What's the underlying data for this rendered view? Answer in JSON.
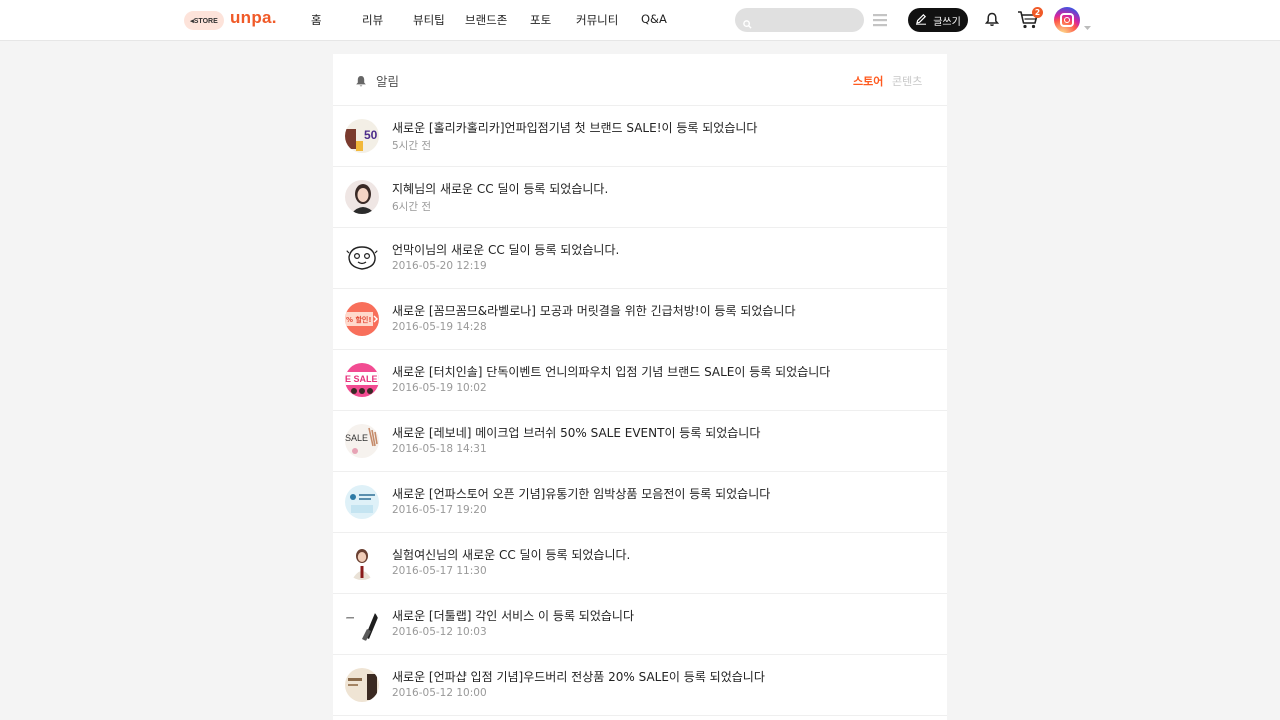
{
  "header": {
    "store_label": "◂STORE",
    "logo_text": "unpa.",
    "nav": [
      {
        "label": "홈"
      },
      {
        "label": "리뷰"
      },
      {
        "label": "뷰티팁"
      },
      {
        "label": "브랜드존"
      },
      {
        "label": "포토"
      },
      {
        "label": "커뮤니티"
      },
      {
        "label": "Q&A"
      }
    ],
    "search": {
      "placeholder": "",
      "value": ""
    },
    "write_label": "글쓰기",
    "cart_count": "2",
    "icons": [
      "search-icon",
      "menu-icon",
      "pencil-icon",
      "bell-icon",
      "cart-icon",
      "profile-avatar",
      "chevron-down-icon"
    ]
  },
  "notifications": {
    "title": "알림",
    "tabs": [
      {
        "label": "스토어",
        "active": true
      },
      {
        "label": "콘텐츠",
        "active": false
      }
    ],
    "items": [
      {
        "message": "새로운 [홀리카홀리카]언파입점기념 첫 브랜드 SALE!이 등록 되었습니다",
        "time": "5시간 전",
        "thumb": "50"
      },
      {
        "message": "지혜님의 새로운 CC 딜이 등록 되었습니다.",
        "time": "6시간 전",
        "thumb": ""
      },
      {
        "message": "언막이님의 새로운 CC 딜이 등록 되었습니다.",
        "time": "2016-05-20 12:19",
        "thumb": ""
      },
      {
        "message": "새로운 [꼼므꼼므&라벨로나] 모공과 머릿결을 위한 긴급처방!이 등록 되었습니다",
        "time": "2016-05-19 14:28",
        "thumb": "% 할인!"
      },
      {
        "message": "새로운 [터치인솔] 단독이벤트 언니의파우치 입점 기념 브랜드 SALE이 등록 되었습니다",
        "time": "2016-05-19 10:02",
        "thumb": "E SALE 3"
      },
      {
        "message": "새로운 [레보네] 메이크업 브러쉬 50% SALE EVENT이 등록 되었습니다",
        "time": "2016-05-18 14:31",
        "thumb": "SALE"
      },
      {
        "message": "새로운 [언파스토어 오픈 기념]유통기한 임박상품 모음전이 등록 되었습니다",
        "time": "2016-05-17 19:20",
        "thumb": ""
      },
      {
        "message": "실험여신님의 새로운 CC 딜이 등록 되었습니다.",
        "time": "2016-05-17 11:30",
        "thumb": ""
      },
      {
        "message": "새로운 [더툴랩] 각인 서비스 이 등록 되었습니다",
        "time": "2016-05-12 10:03",
        "thumb": ""
      },
      {
        "message": "새로운 [언파샵 입점 기념]우드버리 전상품 20% SALE이 등록 되었습니다",
        "time": "2016-05-12 10:00",
        "thumb": ""
      }
    ]
  },
  "colors": {
    "accent": "#ff5a1f",
    "logo": "#f05a28",
    "write_button": "#111111",
    "background": "#f4f4f4"
  }
}
